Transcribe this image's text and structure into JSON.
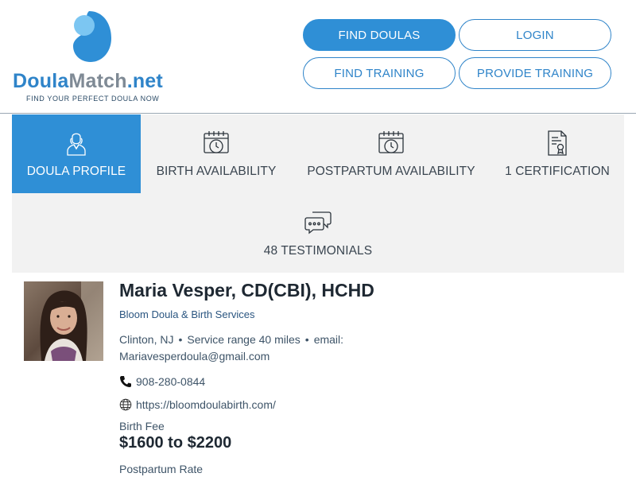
{
  "brand": {
    "name_part1": "Doula",
    "name_part2": "Match",
    "name_part3": ".net",
    "tagline": "FIND YOUR PERFECT DOULA NOW",
    "primary_color": "#2f8fd6",
    "light_color": "#7cc6f2",
    "grey_color": "#7f8a95"
  },
  "nav": {
    "find_doulas": "FIND DOULAS",
    "login": "LOGIN",
    "find_training": "FIND TRAINING",
    "provide_training": "PROVIDE TRAINING"
  },
  "tabs": [
    {
      "label": "DOULA PROFILE",
      "icon": "doula-person-icon",
      "active": true
    },
    {
      "label": "BIRTH AVAILABILITY",
      "icon": "calendar-clock-icon",
      "active": false
    },
    {
      "label": "POSTPARTUM AVAILABILITY",
      "icon": "calendar-clock-icon",
      "active": false
    },
    {
      "label": "1 CERTIFICATION",
      "icon": "certificate-icon",
      "active": false
    },
    {
      "label": "48 TESTIMONIALS",
      "icon": "chat-bubbles-icon",
      "active": false
    }
  ],
  "profile": {
    "name": "Maria Vesper, CD(CBI), HCHD",
    "business": "Bloom Doula & Birth Services",
    "location": "Clinton, NJ",
    "service_range": "Service range 40 miles",
    "email_label": "email:",
    "email": "Mariavesperdoula@gmail.com",
    "phone": "908-280-0844",
    "website": "https://bloomdoulabirth.com/",
    "birth_fee_label": "Birth Fee",
    "birth_fee": "$1600 to $2200",
    "postpartum_rate_label": "Postpartum Rate"
  }
}
